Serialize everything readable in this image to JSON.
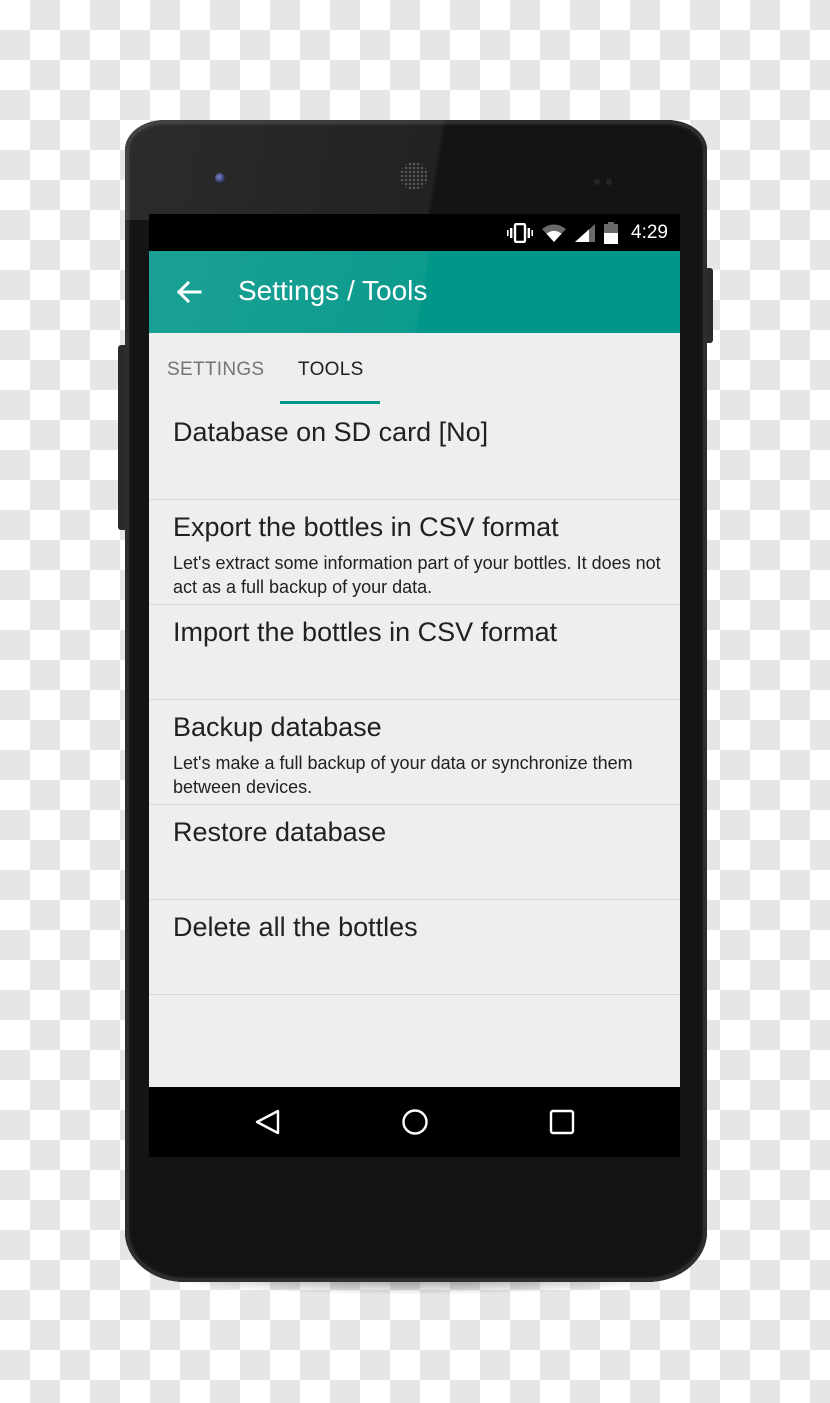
{
  "status_bar": {
    "icons": [
      "vibrate-icon",
      "wifi-icon",
      "signal-icon",
      "battery-icon"
    ],
    "time": "4:29"
  },
  "app_bar": {
    "back_icon": "arrow-left-icon",
    "title": "Settings / Tools",
    "color": "#009688"
  },
  "tabs": [
    {
      "label": "SETTINGS",
      "selected": false
    },
    {
      "label": "TOOLS",
      "selected": true
    }
  ],
  "items": [
    {
      "title": "Database on SD card [No]",
      "subtitle": ""
    },
    {
      "title": "Export the bottles in CSV format",
      "subtitle": "Let's extract some information part of your bottles. It does not act as a full backup of your data."
    },
    {
      "title": "Import the bottles in CSV format",
      "subtitle": ""
    },
    {
      "title": "Backup database",
      "subtitle": "Let's make a full backup of your data or synchronize them between devices."
    },
    {
      "title": "Restore database",
      "subtitle": ""
    },
    {
      "title": "Delete all the bottles",
      "subtitle": ""
    }
  ],
  "nav_bar": {
    "buttons": [
      "back-triangle-icon",
      "home-circle-icon",
      "recents-square-icon"
    ]
  }
}
